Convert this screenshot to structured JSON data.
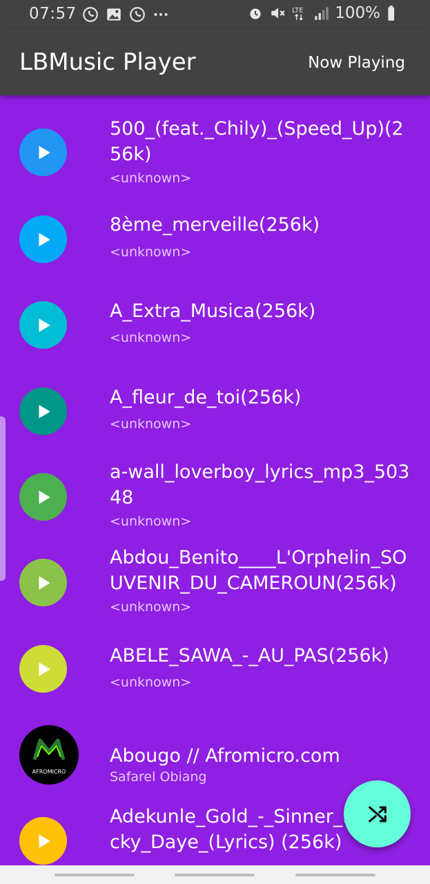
{
  "status_bar": {
    "time": "07:57",
    "battery": "100%",
    "left_icons": [
      "whatsapp-icon",
      "gallery-icon",
      "whatsapp-icon",
      "more-dots-icon"
    ],
    "right_icons": [
      "alarm-icon",
      "mute-icon",
      "lte-icon",
      "signal-icon",
      "battery-icon"
    ]
  },
  "app_bar": {
    "title": "LBMusic Player",
    "now_playing_label": "Now Playing"
  },
  "tracks": [
    {
      "title": "500_(feat._Chily)_(Speed_Up)(256k)",
      "artist": "<unknown>",
      "color": "#2196f3"
    },
    {
      "title": "8ème_merveille(256k)",
      "artist": "<unknown>",
      "color": "#03a9f4"
    },
    {
      "title": "A_Extra_Musica(256k)",
      "artist": "<unknown>",
      "color": "#00bcd4"
    },
    {
      "title": "A_fleur_de_toi(256k)",
      "artist": "<unknown>",
      "color": "#009688"
    },
    {
      "title": "a-wall_loverboy_lyrics_mp3_50348",
      "artist": "<unknown>",
      "color": "#4caf50"
    },
    {
      "title": "Abdou_Benito____L'Orphelin_SOUVENIR_DU_CAMEROUN(256k)",
      "artist": "<unknown>",
      "color": "#8bc34a"
    },
    {
      "title": "ABELE_SAWA_-_AU_PAS(256k)",
      "artist": "<unknown>",
      "color": "#cddc39"
    },
    {
      "title": "Abougo // Afromicro.com",
      "artist": "Safarel Obiang",
      "logo_text": "AFROMICRO",
      "color": "#000000"
    },
    {
      "title": "Adekunle_Gold_-_Sinner_Ft._Lucky_Daye_(Lyrics) (256k)",
      "artist": "",
      "color": "#ffc107"
    }
  ],
  "fab": {
    "icon": "shuffle-icon",
    "color": "#64ffda"
  },
  "theme": {
    "background": "#8f1fe2",
    "appbar": "#424242"
  }
}
